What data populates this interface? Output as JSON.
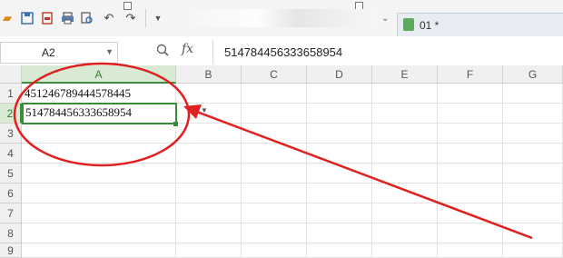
{
  "toolbar": {
    "icons": [
      "folder-open-icon",
      "save-icon",
      "export-pdf-icon",
      "print-icon",
      "print-preview-icon",
      "undo-icon",
      "redo-icon",
      "more-dropdown-icon"
    ],
    "document_tab": "01 *"
  },
  "formula_bar": {
    "name_box": "A2",
    "fx_label": "fx",
    "formula": "514784456333658954"
  },
  "columns": [
    "A",
    "B",
    "C",
    "D",
    "E",
    "F",
    "G"
  ],
  "rows": [
    "1",
    "2",
    "3",
    "4",
    "5",
    "6",
    "7",
    "8",
    "9"
  ],
  "cells": {
    "A1": "451246789444578445",
    "A2": "514784456333658954"
  },
  "selected_cell": "A2",
  "colors": {
    "selection": "#3a8a3a",
    "annotation": "#e02020",
    "header_active_bg": "#d8ead4"
  }
}
